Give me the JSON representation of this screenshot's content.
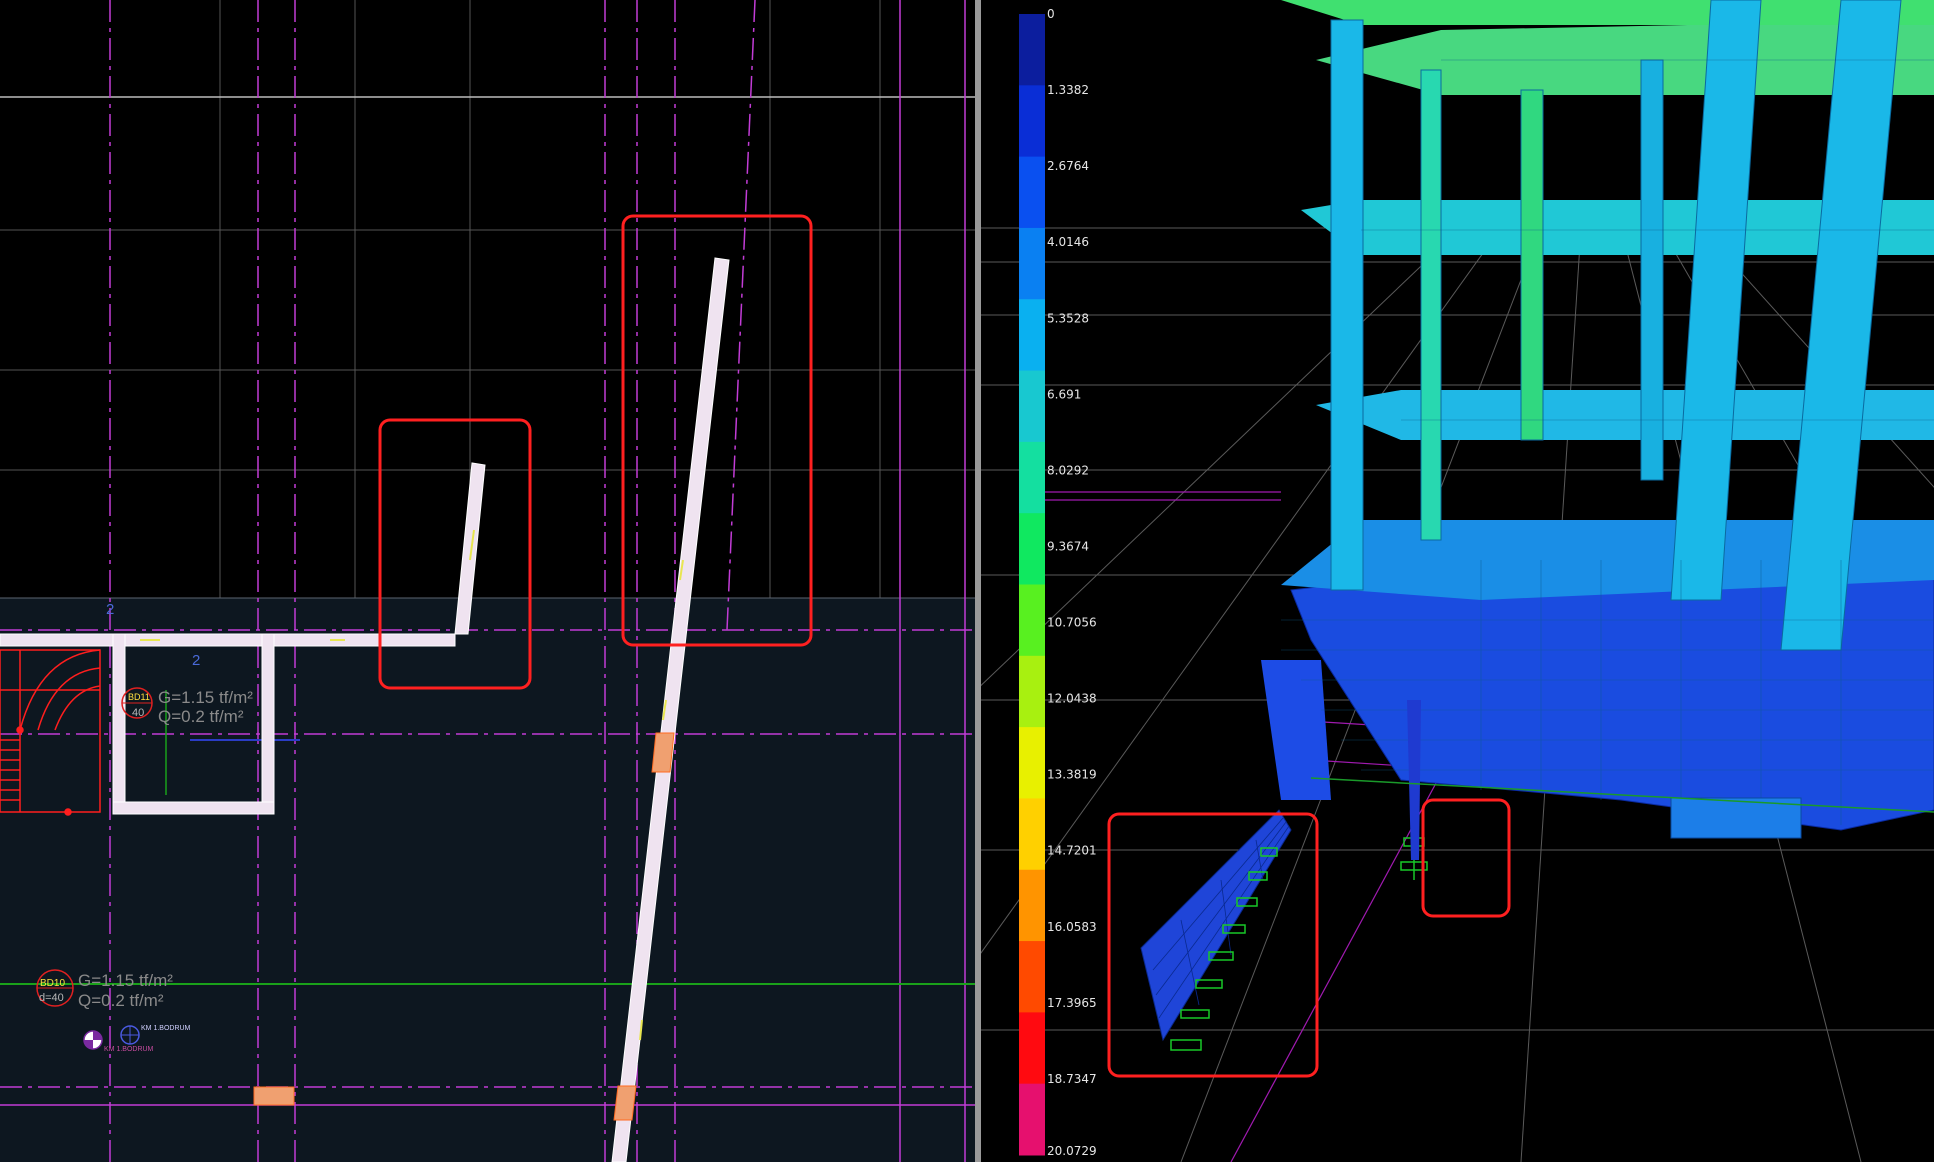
{
  "left_view": {
    "axis_labels": [
      "2",
      "2"
    ],
    "slab_top": {
      "id": "BD11",
      "thickness": "40",
      "dead_load": "G=1.15 tf/m²",
      "live_load": "Q=0.2 tf/m²"
    },
    "slab_bottom": {
      "id": "BD10",
      "thickness": "d=40",
      "dead_load": "G=1.15 tf/m²",
      "live_load": "Q=0.2 tf/m²"
    },
    "marker_a": "KM 1.BODRUM",
    "marker_b": "KM 1.BODRUM",
    "colors": {
      "grid_magenta": "#c23cd6",
      "slab_fill": "#0d1720",
      "highlight_red": "#ff2020",
      "wall_fill": "#efe3f0",
      "stair_red": "#ff1e1e"
    }
  },
  "right_view": {
    "legend": {
      "values": [
        "0",
        "1.3382",
        "2.6764",
        "4.0146",
        "5.3528",
        "6.691",
        "8.0292",
        "9.3674",
        "10.7056",
        "12.0438",
        "13.3819",
        "14.7201",
        "16.0583",
        "17.3965",
        "18.7347",
        "20.0729"
      ],
      "colors": [
        "#0c1e9e",
        "#0a2ed6",
        "#0a50f0",
        "#0a80f2",
        "#0ab0f0",
        "#18c8d0",
        "#14dfa0",
        "#10e860",
        "#58f020",
        "#a8f010",
        "#e8f000",
        "#ffd000",
        "#ff9400",
        "#ff4a00",
        "#ff0a10",
        "#e6106e"
      ]
    },
    "colors": {
      "highlight_red": "#ff2020",
      "support_green": "#18c828",
      "ground_grid": "#6a6a6a"
    }
  }
}
